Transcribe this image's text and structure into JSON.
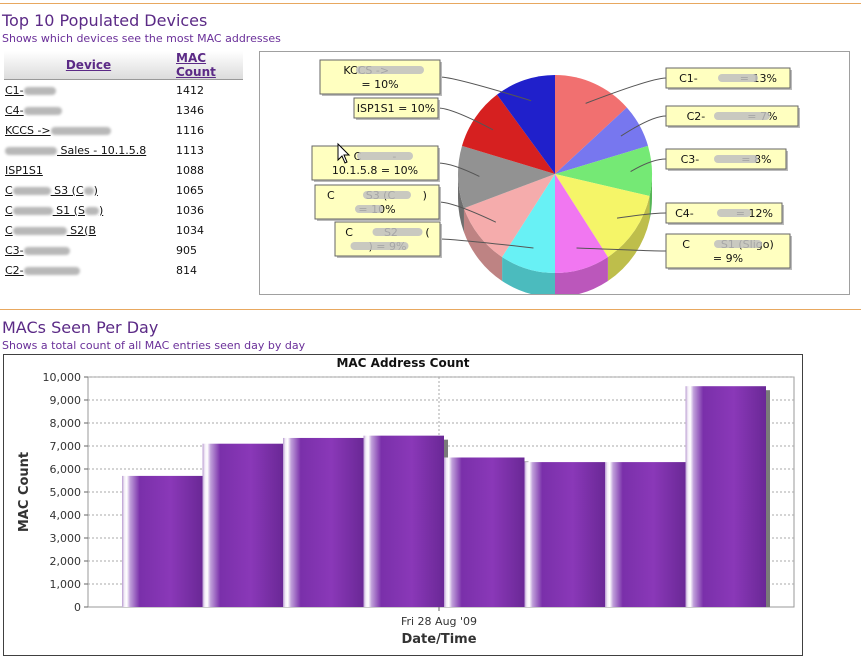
{
  "section1": {
    "title": "Top 10 Populated Devices",
    "subtitle": "Shows which devices see the most MAC addresses"
  },
  "table": {
    "headers": {
      "device": "Device",
      "count": "MAC Count"
    },
    "rows": [
      {
        "prefix": "C1-",
        "suffix": "",
        "count": "1412"
      },
      {
        "prefix": "C4-",
        "suffix": "",
        "count": "1346"
      },
      {
        "prefix": "KCCS ->",
        "suffix": "",
        "count": "1116"
      },
      {
        "prefix": "",
        "suffix": " Sales - 10.1.5.8",
        "count": "1113"
      },
      {
        "prefix": "ISP1S1",
        "suffix": "",
        "count": "1088"
      },
      {
        "prefix": "C",
        "suffix": " S3 (C",
        "count": "1065"
      },
      {
        "prefix": "C",
        "suffix": " S1 (S",
        "count": "1036"
      },
      {
        "prefix": "C",
        "suffix": " S2(B",
        "count": "1034"
      },
      {
        "prefix": "C3-",
        "suffix": "",
        "count": "905"
      },
      {
        "prefix": "C2-",
        "suffix": "",
        "count": "814"
      }
    ]
  },
  "pie": {
    "slices": [
      {
        "label": [
          "C1-",
          " = 13%"
        ],
        "value": 13,
        "color": "#f06868"
      },
      {
        "label": [
          "C2-",
          " = 7%"
        ],
        "value": 7,
        "color": "#7070ee"
      },
      {
        "label": [
          "C3-",
          " = 8%"
        ],
        "value": 8,
        "color": "#6ee86e"
      },
      {
        "label": [
          "C4-",
          " = 12%"
        ],
        "value": 12,
        "color": "#f4f460"
      },
      {
        "label": [
          "C",
          " S1 (Sligo)",
          "= 9%"
        ],
        "value": 9,
        "color": "#f070f0"
      },
      {
        "label": [
          "C",
          " S2",
          "(",
          ") = 9%"
        ],
        "value": 9,
        "color": "#60f0f4"
      },
      {
        "label": [
          "C",
          " S3 (C",
          ")",
          "= 10%"
        ],
        "value": 10,
        "color": "#f4a8a8"
      },
      {
        "label": [
          "C",
          " -",
          "10.1.5.8 = 10%"
        ],
        "value": 10,
        "color": "#8c8c8c"
      },
      {
        "label": [
          "ISP1S1 = 10%"
        ],
        "value": 10,
        "color": "#d41414"
      },
      {
        "label": [
          "KCCS ->",
          "",
          "= 10%"
        ],
        "value": 10,
        "color": "#1414c8"
      }
    ]
  },
  "section2": {
    "title": "MACs Seen Per Day",
    "subtitle": "Shows a total count of all MAC entries seen day by day"
  },
  "chart_data": {
    "type": "bar",
    "title": "MAC Address Count",
    "xlabel": "Date/Time",
    "ylabel": "MAC Count",
    "ylim": [
      0,
      10000
    ],
    "yticks": [
      "0",
      "1,000",
      "2,000",
      "3,000",
      "4,000",
      "5,000",
      "6,000",
      "7,000",
      "8,000",
      "9,000",
      "10,000"
    ],
    "xtick": "Fri 28 Aug '09",
    "values": [
      5700,
      7100,
      7350,
      7450,
      6500,
      6300,
      6300,
      9600
    ],
    "bar_color": "#8a38b8",
    "grid": true
  }
}
